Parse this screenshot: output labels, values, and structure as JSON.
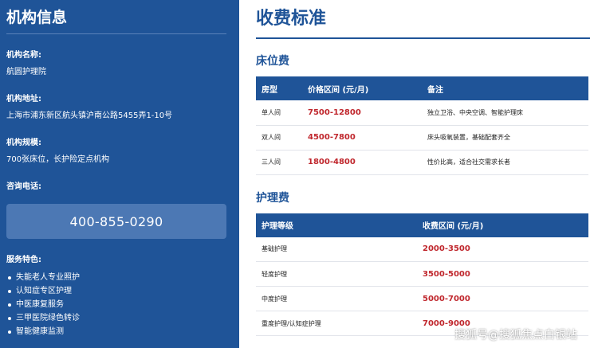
{
  "sidebar": {
    "title": "机构信息",
    "name_label": "机构名称:",
    "name_value": "航圆护理院",
    "address_label": "机构地址:",
    "address_value": "上海市浦东新区航头镇沪南公路5455弄1-10号",
    "scale_label": "机构规模:",
    "scale_value": "700张床位，长护险定点机构",
    "phone_label": "咨询电话:",
    "phone_value": "400-855-0290",
    "features_label": "服务特色:",
    "features": [
      "失能老人专业照护",
      "认知症专区护理",
      "中医康复服务",
      "三甲医院绿色转诊",
      "智能健康监测"
    ]
  },
  "main": {
    "title": "收费标准",
    "bed": {
      "title": "床位费",
      "headers": [
        "房型",
        "价格区间 (元/月)",
        "备注"
      ],
      "rows": [
        [
          "单人间",
          "7500-12800",
          "独立卫浴、中央空调、智能护理床"
        ],
        [
          "双人间",
          "4500-7800",
          "床头吸氧装置，基础配套齐全"
        ],
        [
          "三人间",
          "1800-4800",
          "性价比高，适合社交需求长者"
        ]
      ]
    },
    "care": {
      "title": "护理费",
      "headers": [
        "护理等级",
        "收费区间 (元/月)"
      ],
      "rows": [
        [
          "基础护理",
          "2000-3500"
        ],
        [
          "轻度护理",
          "3500-5000"
        ],
        [
          "中度护理",
          "5000-7000"
        ],
        [
          "重度护理/认知症护理",
          "7000-9000"
        ]
      ]
    }
  },
  "watermark": "搜狐号@搜狐焦点白银站"
}
